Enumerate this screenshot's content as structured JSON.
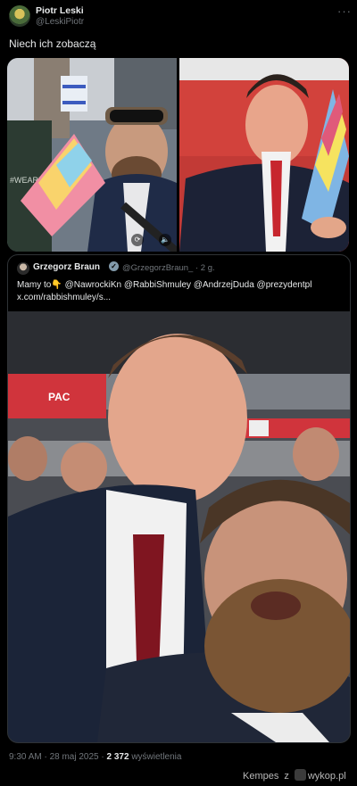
{
  "author": {
    "name": "Piotr Leski",
    "handle": "@LeskiPiotr"
  },
  "more_icon": "more-horizontal-icon",
  "post_text": "Niech ich zobaczą",
  "quoted": {
    "name": "Grzegorz Braun",
    "handle_time": "@GrzegorzBraun_ · 2 g.",
    "text_line1_prefix": "Mamy to",
    "emoji": "👇",
    "text_line1_mentions": " @NawrockiKn @RabbiShmuley @AndrzejDuda @prezydentpl",
    "text_line2": "x.com/rabbishmuley/s..."
  },
  "footer": {
    "time": "9:30 AM · 28 maj 2025 · ",
    "views": "2 372",
    "views_label": " wyświetlenia"
  },
  "watermark": {
    "left": "Kempes",
    "mid": "z",
    "right": "wykop.pl"
  },
  "colors": {
    "bg": "#000000",
    "muted": "#71767b",
    "text": "#e7e9ea",
    "border": "#2f3336"
  }
}
